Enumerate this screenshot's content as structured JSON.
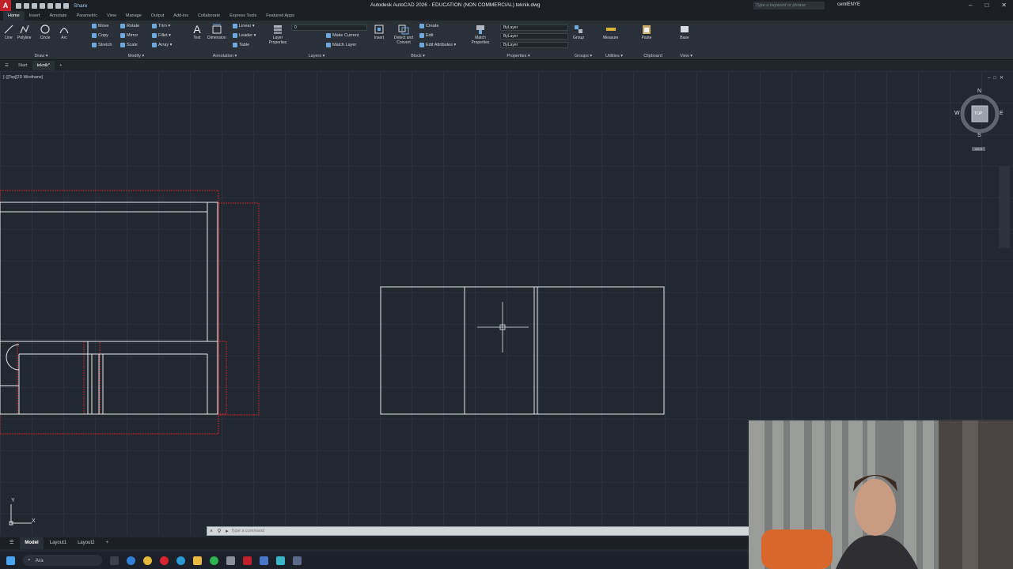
{
  "titlebar": {
    "app_icon": "A",
    "share_label": "Share",
    "title": "Autodesk AutoCAD 2026 - EDUCATION (NON COMMERCIAL)   teknik.dwg",
    "search_placeholder": "Type a keyword or phrase",
    "user": "cemlENYE",
    "controls": [
      "–",
      "□",
      "✕"
    ]
  },
  "ribbon_tabs": [
    "Home",
    "Insert",
    "Annotate",
    "Parametric",
    "View",
    "Manage",
    "Output",
    "Add-ins",
    "Collaborate",
    "Express Tools",
    "Featured Apps"
  ],
  "ribbon": {
    "draw": {
      "label": "Draw ▾",
      "buttons": [
        "Line",
        "Polyline",
        "Circle",
        "Arc"
      ]
    },
    "modify": {
      "label": "Modify ▾",
      "items": [
        "Move",
        "Rotate",
        "Trim ▾",
        "Copy",
        "Mirror",
        "Fillet ▾",
        "Stretch",
        "Scale",
        "Array ▾"
      ]
    },
    "annotation": {
      "label": "Annotation ▾",
      "buttons": [
        "Text",
        "Dimension"
      ],
      "items": [
        "Linear ▾",
        "Leader ▾",
        "Table"
      ]
    },
    "layers": {
      "label": "Layers ▾",
      "button": "Layer Properties",
      "items": [
        "Make Current",
        "Match Layer"
      ],
      "layer_value": "0"
    },
    "block": {
      "label": "Block ▾",
      "buttons": [
        "Insert",
        "Detect and Convert"
      ],
      "items": [
        "Create",
        "Edit",
        "Edit Attributes ▾"
      ]
    },
    "properties": {
      "label": "Properties ▾",
      "button": "Match Properties",
      "values": [
        "ByLayer",
        "ByLayer",
        "ByLayer"
      ]
    },
    "groups": {
      "label": "Groups ▾",
      "button": "Group"
    },
    "utilities": {
      "label": "Utilities ▾",
      "button": "Measure"
    },
    "clipboard": {
      "label": "Clipboard",
      "button": "Paste"
    },
    "view": {
      "label": "View ▾",
      "button": "Base"
    }
  },
  "file_tabs": [
    "Start",
    "teknik*"
  ],
  "viewport": {
    "label": "[–][Top][2D Wireframe]",
    "controls": [
      "–",
      "□",
      "✕"
    ],
    "viewcube": {
      "top": "TOP",
      "n": "N",
      "s": "S",
      "e": "E",
      "w": "W",
      "wcs": "WCS"
    },
    "ucs": {
      "y": "Y",
      "x": "X"
    }
  },
  "command_line": {
    "placeholder": "Type a command"
  },
  "layout_tabs": [
    "Model",
    "Layout1",
    "Layout2"
  ],
  "taskbar": {
    "search_label": "Ara"
  },
  "icons": [
    "windows-start-icon",
    "search-icon",
    "chrome-icon",
    "opera-icon",
    "edge-icon",
    "folder-icon",
    "spotify-icon",
    "autocad-icon"
  ]
}
